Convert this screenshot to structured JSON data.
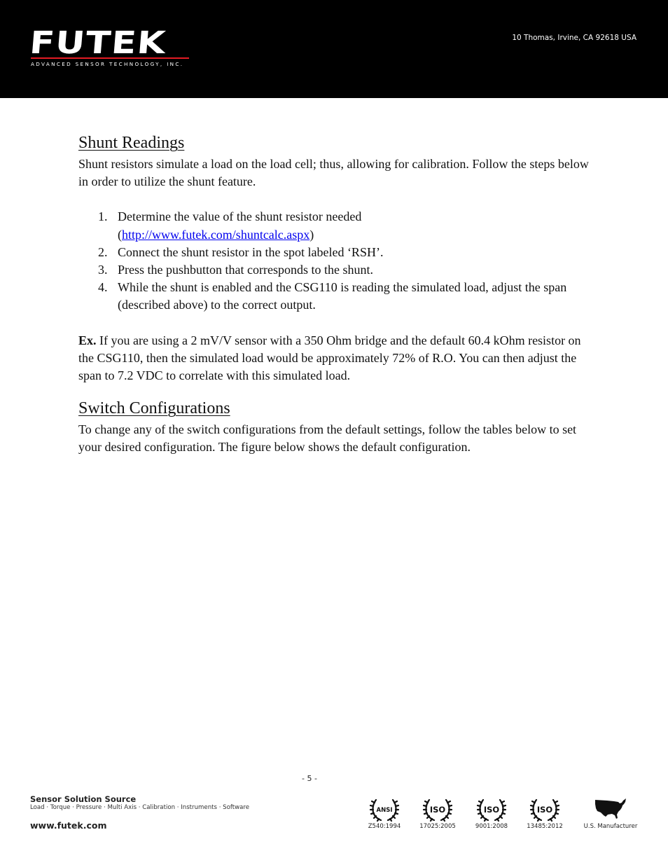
{
  "header": {
    "logo_word": "FUTEK",
    "logo_tagline": "ADVANCED SENSOR TECHNOLOGY, INC.",
    "address": "10 Thomas, Irvine, CA 92618 USA",
    "accent_color": "#e31b23"
  },
  "sections": {
    "shunt": {
      "title": "Shunt Readings",
      "intro": "Shunt resistors simulate a load on the load cell; thus, allowing for calibration.  Follow the steps below in order to utilize the shunt feature.",
      "steps": [
        {
          "num": "1.",
          "text": "Determine the value of the shunt resistor needed",
          "link_open": "(",
          "link_text": "http://www.futek.com/shuntcalc.aspx",
          "link_close": ")"
        },
        {
          "num": "2.",
          "text": "Connect the shunt resistor in the spot labeled ‘RSH’."
        },
        {
          "num": "3.",
          "text": "Press the pushbutton that corresponds to the shunt."
        },
        {
          "num": "4.",
          "text": "While the shunt is enabled and the CSG110 is reading the simulated load, adjust the span (described above) to the correct output."
        }
      ],
      "example_label": "Ex.",
      "example_text": " If you are using a 2 mV/V sensor with a 350 Ohm bridge and the default 60.4 kOhm resistor on the CSG110, then the simulated load would be approximately 72% of R.O. You can then adjust the span to 7.2 VDC to correlate with this simulated load."
    },
    "switch": {
      "title": "Switch Configurations",
      "intro": "To change any of the switch configurations from the default settings, follow the tables below to set your desired configuration.  The figure below shows the default configuration."
    }
  },
  "page_number": "- 5 -",
  "footer": {
    "title": "Sensor Solution Source",
    "subtitle": "Load · Torque · Pressure · Multi Axis · Calibration · Instruments · Software",
    "url": "www.futek.com",
    "certs": [
      {
        "badge": "ANSI",
        "code": "Z540:1994"
      },
      {
        "badge": "ISO",
        "code": "17025:2005"
      },
      {
        "badge": "ISO",
        "code": "9001:2008"
      },
      {
        "badge": "ISO",
        "code": "13485:2012"
      }
    ],
    "us_label": "U.S. Manufacturer"
  }
}
